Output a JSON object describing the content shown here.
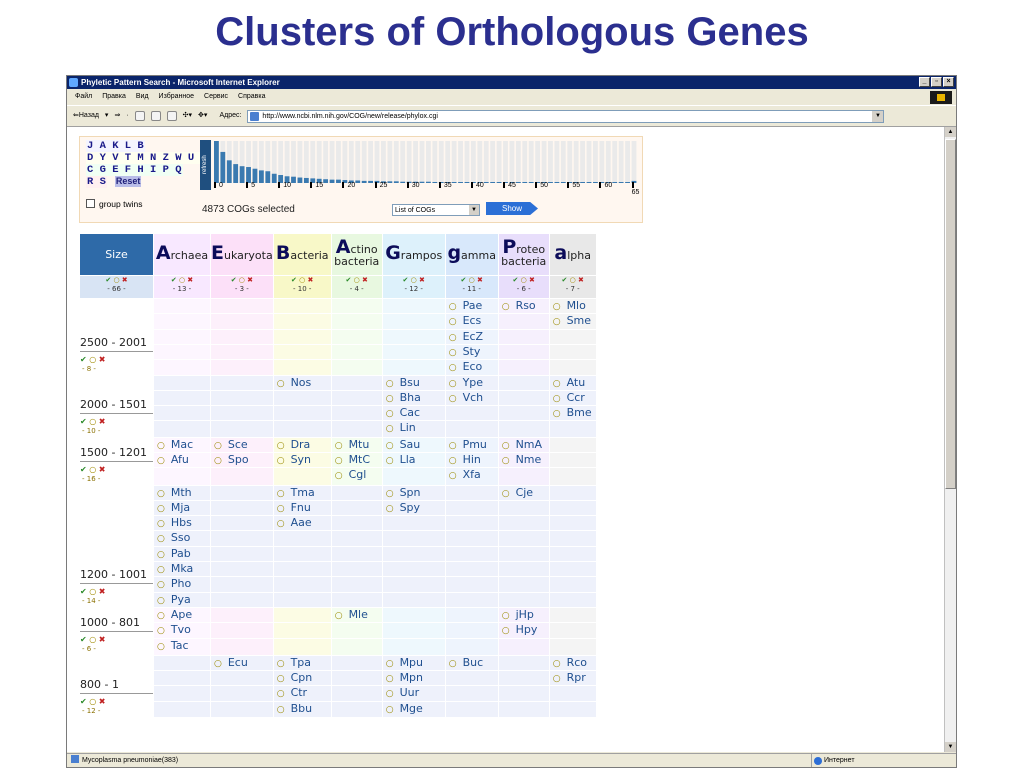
{
  "slide": {
    "title": "Clusters of Orthologous Genes"
  },
  "window": {
    "title": "Phyletic Pattern Search - Microsoft Internet Explorer",
    "menu": [
      "Файл",
      "Правка",
      "Вид",
      "Избранное",
      "Сервис",
      "Справка"
    ],
    "toolbar": {
      "back": "⇐Назад",
      "address_label": "Адрес:",
      "url": "http://www.ncbi.nlm.nih.gov/COG/new/release/phylox.cgi"
    },
    "status": {
      "left": "Mycoplasma pneumoniae(383)",
      "zone": "Интернет"
    }
  },
  "panel": {
    "letters": [
      "J A K L B",
      "D Y V T M N Z W U O",
      "C G E F H I P Q",
      "R S"
    ],
    "reset_label": "Reset",
    "refresh_label": "refresh",
    "axis_ticks": [
      "0",
      "5",
      "10",
      "15",
      "20",
      "25",
      "30",
      "35",
      "40",
      "45",
      "50",
      "55",
      "60",
      "65"
    ],
    "group_twins_label": "group twins",
    "selected_text": "4873 COGs selected",
    "select_value": "List of COGs",
    "show_label": "Show"
  },
  "histogram": {
    "values": [
      100,
      74,
      54,
      45,
      40,
      38,
      34,
      30,
      28,
      22,
      19,
      16,
      15,
      13,
      12,
      11,
      10,
      9,
      8,
      8,
      7,
      6,
      6,
      5,
      5,
      5,
      4,
      4,
      4,
      3,
      3,
      3,
      3,
      3,
      2,
      2,
      2,
      2,
      2,
      2,
      2,
      2,
      2,
      2,
      2,
      2,
      2,
      2,
      2,
      2,
      2,
      2,
      2,
      2,
      2,
      2,
      2,
      2,
      2,
      2,
      2,
      2,
      2,
      2,
      2,
      5
    ],
    "bar_color": "#3a7ab0",
    "empty_color": "#eaeaea"
  },
  "table": {
    "size_header": "Size",
    "groups": [
      {
        "big": "A",
        "rest": "rchaea",
        "rest2": "",
        "count": "- 13 -",
        "color": "#f8e8ff"
      },
      {
        "big": "E",
        "rest": "ukaryota",
        "rest2": "",
        "count": "- 3 -",
        "color": "#fce0f8"
      },
      {
        "big": "B",
        "rest": "acteria",
        "rest2": "",
        "count": "- 10 -",
        "color": "#f8f8c8"
      },
      {
        "big": "A",
        "rest": "ctino",
        "rest2": "bacteria",
        "count": "- 4 -",
        "color": "#e8f8e0"
      },
      {
        "big": "G",
        "rest": "rampos",
        "rest2": "",
        "count": "- 12 -",
        "color": "#ddf1fb"
      },
      {
        "big": "g",
        "rest": "amma",
        "rest2": "",
        "count": "- 11 -",
        "color": "#d8e8fb"
      },
      {
        "big": "P",
        "rest": "roteo",
        "rest2": "bacteria",
        "count": "- 6 -",
        "color": "#e8defb"
      },
      {
        "big": "a",
        "rest": "lpha",
        "rest2": "",
        "count": "- 7 -",
        "color": "#e8e8e8"
      }
    ],
    "size_total": "- 66 -",
    "blocks": [
      {
        "label": "2500 - 2001",
        "count": "- 8 -",
        "rows": 5,
        "cols": [
          [],
          [],
          [],
          [],
          [],
          [
            "Pae",
            "Ecs",
            "EcZ",
            "Sty",
            "Eco"
          ],
          [
            "Rso"
          ],
          [
            "Mlo",
            "Sme"
          ]
        ]
      },
      {
        "label": "2000 - 1501",
        "count": "- 10 -",
        "rows": 4,
        "cols": [
          [],
          [],
          [
            "Nos"
          ],
          [],
          [
            "Bsu",
            "Bha",
            "Cac",
            "Lin"
          ],
          [
            "Ype",
            "Vch"
          ],
          [],
          [
            "Atu",
            "Ccr",
            "Bme"
          ]
        ]
      },
      {
        "label": "1500 - 1201",
        "count": "- 16 -",
        "rows": 3,
        "cols": [
          [
            "Mac",
            "Afu"
          ],
          [
            "Sce",
            "Spo"
          ],
          [
            "Dra",
            "Syn"
          ],
          [
            "Mtu",
            "MtC",
            "Cgl"
          ],
          [
            "Sau",
            "Lla"
          ],
          [
            "Pmu",
            "Hin",
            "Xfa"
          ],
          [
            "NmA",
            "Nme"
          ],
          []
        ]
      },
      {
        "label": "1200 - 1001",
        "count": "- 14 -",
        "rows": 8,
        "cols": [
          [
            "Mth",
            "Mja",
            "Hbs",
            "Sso",
            "Pab",
            "Mka",
            "Pho",
            "Pya"
          ],
          [],
          [
            "Tma",
            "Fnu",
            "Aae"
          ],
          [],
          [
            "Spn",
            "Spy"
          ],
          [],
          [
            "Cje"
          ],
          []
        ]
      },
      {
        "label": "1000 - 801",
        "count": "- 6 -",
        "rows": 3,
        "cols": [
          [
            "Ape",
            "Tvo",
            "Tac"
          ],
          [],
          [],
          [
            "Mle"
          ],
          [],
          [],
          [
            "jHp",
            "Hpy"
          ],
          []
        ]
      },
      {
        "label": "800 - 1",
        "count": "- 12 -",
        "rows": 4,
        "cols": [
          [],
          [
            "Ecu"
          ],
          [
            "Tpa",
            "Cpn",
            "Ctr",
            "Bbu"
          ],
          [],
          [
            "Mpu",
            "Mpn",
            "Uur",
            "Mge"
          ],
          [
            "Buc"
          ],
          [],
          [
            "Rco",
            "Rpr"
          ]
        ]
      }
    ]
  }
}
